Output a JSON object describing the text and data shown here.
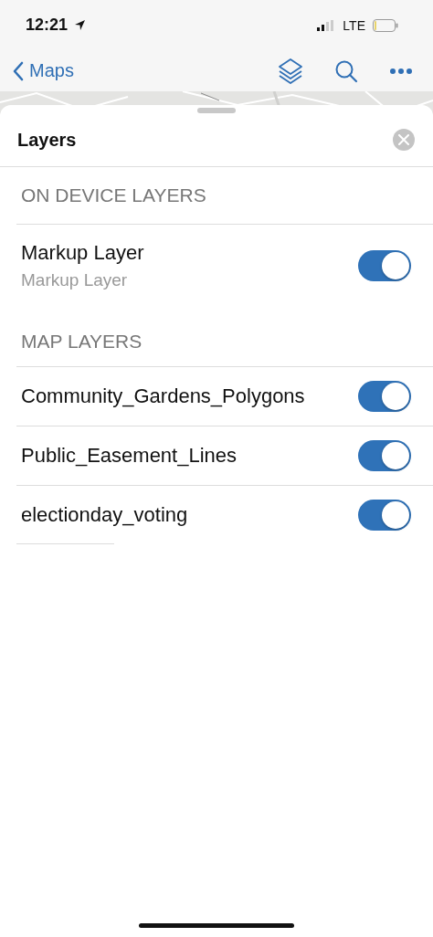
{
  "status_bar": {
    "time": "12:21",
    "network": "LTE"
  },
  "nav": {
    "back_label": "Maps"
  },
  "sheet": {
    "title": "Layers",
    "sections": [
      {
        "header": "ON DEVICE LAYERS",
        "rows": [
          {
            "name": "Markup Layer",
            "subtitle": "Markup Layer",
            "on": true
          }
        ]
      },
      {
        "header": "MAP LAYERS",
        "rows": [
          {
            "name": "Community_Gardens_Polygons",
            "on": true
          },
          {
            "name": "Public_Easement_Lines",
            "on": true
          },
          {
            "name": "electionday_voting",
            "on": true
          }
        ]
      }
    ]
  }
}
